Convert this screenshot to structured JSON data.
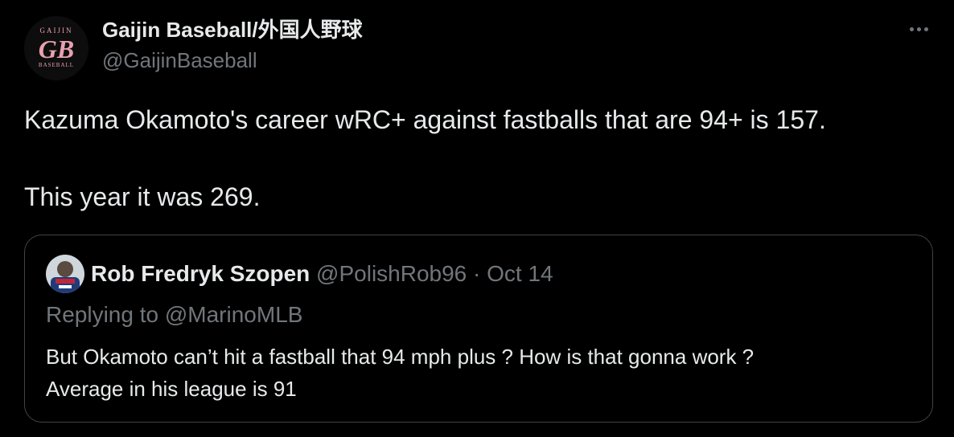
{
  "author": {
    "display_name": "Gaijin Baseball/外国人野球",
    "handle": "@GaijinBaseball",
    "avatar_icon": "gaijin-baseball-logo",
    "logo_text": {
      "top": "GAIJIN",
      "middle": "GB",
      "bottom": "BASEBALL"
    }
  },
  "more_icon": "ellipsis-icon",
  "tweet": {
    "line1": "Kazuma Okamoto's career wRC+ against fastballs that are 94+ is 157.",
    "line2": "This year it was 269."
  },
  "quoted_tweet": {
    "display_name": "Rob Fredryk Szopen",
    "handle": "@PolishRob96",
    "separator": "·",
    "date": "Oct 14",
    "replying_to": "Replying to @MarinoMLB",
    "text_line1": "But Okamoto can’t hit a fastball that 94 mph plus ? How is that gonna work ?",
    "text_line2": "Average in his league is 91"
  },
  "colors": {
    "background": "#000000",
    "primary_text": "#e7e9ea",
    "secondary_text": "#71767b",
    "border": "#3f4348",
    "logo_pink": "#e8a0b0"
  }
}
